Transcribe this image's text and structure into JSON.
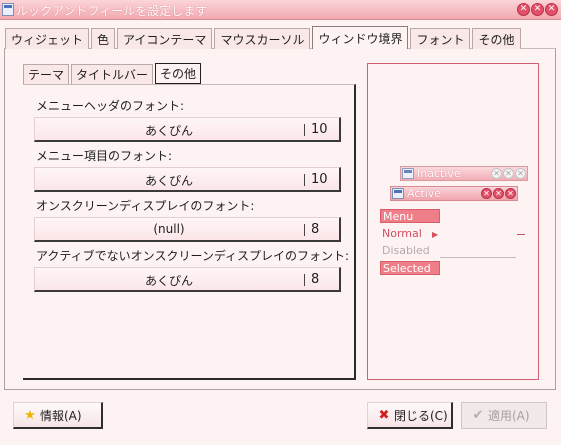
{
  "window": {
    "title": "ルックアンドフィールを設定します",
    "buttons": [
      "✕",
      "✕",
      "✕"
    ]
  },
  "main_tabs": [
    {
      "label": "ウィジェット",
      "active": false
    },
    {
      "label": "色",
      "active": false
    },
    {
      "label": "アイコンテーマ",
      "active": false
    },
    {
      "label": "マウスカーソル",
      "active": false
    },
    {
      "label": "ウィンドウ境界",
      "active": true
    },
    {
      "label": "フォント",
      "active": false
    },
    {
      "label": "その他",
      "active": false
    }
  ],
  "sub_tabs": [
    {
      "label": "テーマ",
      "active": false
    },
    {
      "label": "タイトルバー",
      "active": false
    },
    {
      "label": "その他",
      "active": true
    }
  ],
  "font_rows": [
    {
      "label": "メニューヘッダのフォント:",
      "font": "あくぴん",
      "size": "10"
    },
    {
      "label": "メニュー項目のフォント:",
      "font": "あくぴん",
      "size": "10"
    },
    {
      "label": "オンスクリーンディスプレイのフォント:",
      "font": "(null)",
      "size": "8"
    },
    {
      "label": "アクティブでないオンスクリーンディスプレイのフォント:",
      "font": "あくぴん",
      "size": "8"
    }
  ],
  "preview": {
    "inactive_title": "Inactive",
    "active_title": "Active",
    "menu_items": {
      "header": "Menu",
      "normal": "Normal",
      "disabled": "Disabled",
      "selected": "Selected"
    },
    "accent": "#d55f72"
  },
  "buttons": {
    "info": "情報(A)",
    "close": "閉じる(C)",
    "apply": "適用(A)"
  },
  "icons": {
    "info": "star-icon",
    "close": "x-icon",
    "apply": "check-icon"
  }
}
